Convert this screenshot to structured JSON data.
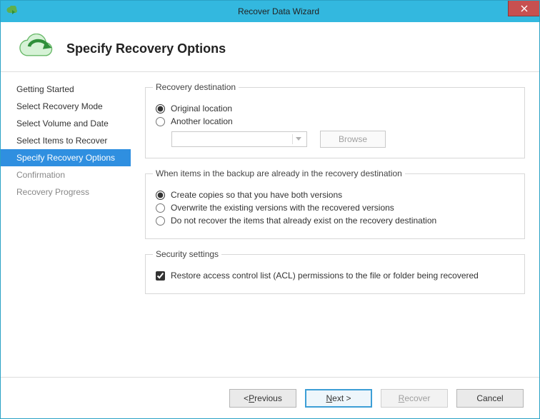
{
  "window": {
    "title": "Recover Data Wizard",
    "close_symbol": "✕"
  },
  "header": {
    "title": "Specify Recovery Options"
  },
  "sidebar": {
    "items": [
      {
        "label": "Getting Started",
        "state": "done"
      },
      {
        "label": "Select Recovery Mode",
        "state": "done"
      },
      {
        "label": "Select Volume and Date",
        "state": "done"
      },
      {
        "label": "Select Items to Recover",
        "state": "done"
      },
      {
        "label": "Specify Recovery Options",
        "state": "active"
      },
      {
        "label": "Confirmation",
        "state": "pending"
      },
      {
        "label": "Recovery Progress",
        "state": "pending"
      }
    ]
  },
  "groups": {
    "destination": {
      "legend": "Recovery destination",
      "options": {
        "original": {
          "label": "Original location",
          "selected": true
        },
        "another": {
          "label": "Another location",
          "selected": false
        }
      },
      "path_value": "",
      "browse_label": "Browse"
    },
    "conflict": {
      "legend": "When items in the backup are already in the recovery destination",
      "options": {
        "copies": {
          "label": "Create copies so that you have both versions",
          "selected": true
        },
        "overwrite": {
          "label": "Overwrite the existing versions with the recovered versions",
          "selected": false
        },
        "skip": {
          "label": "Do not recover the items that already exist on the recovery destination",
          "selected": false
        }
      }
    },
    "security": {
      "legend": "Security settings",
      "acl": {
        "label": "Restore access control list (ACL) permissions to the file or folder being recovered",
        "checked": true
      }
    }
  },
  "footer": {
    "previous_pre": "< ",
    "previous_key": "P",
    "previous_post": "revious",
    "next_key": "N",
    "next_post": "ext >",
    "recover_key": "R",
    "recover_post": "ecover",
    "cancel": "Cancel"
  }
}
